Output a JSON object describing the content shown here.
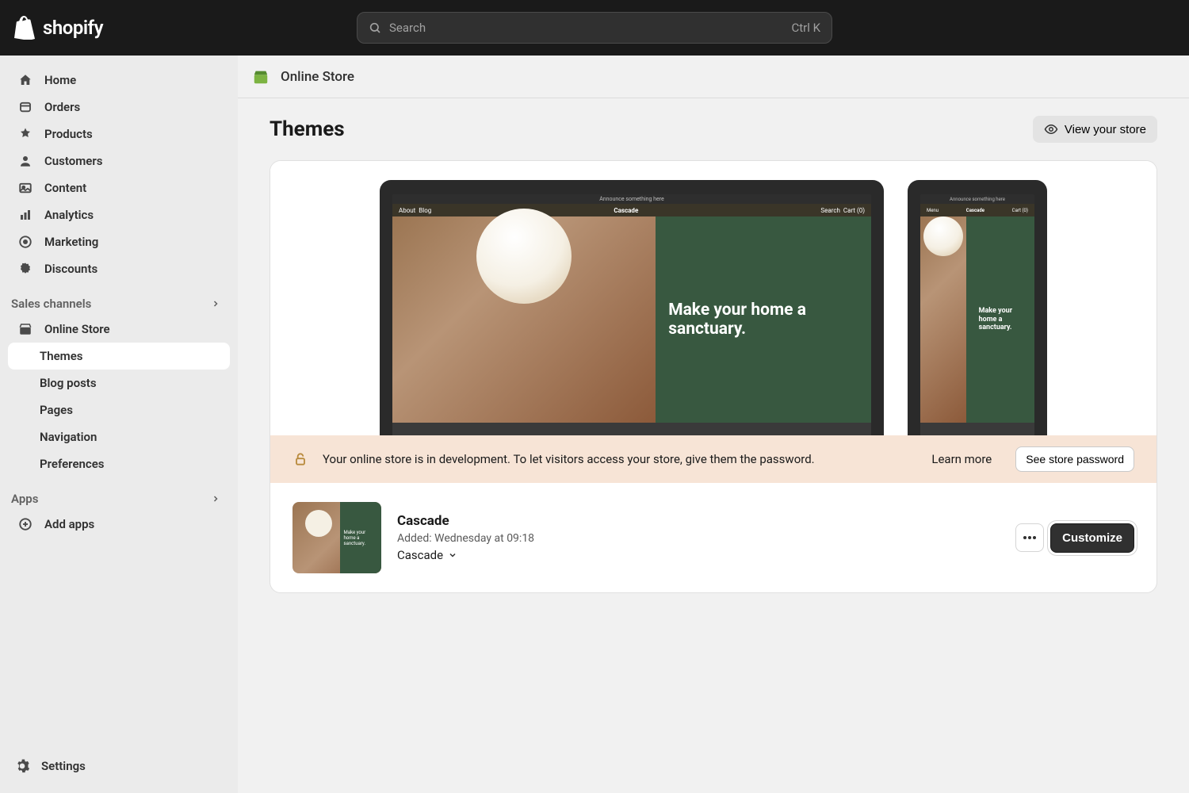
{
  "brand": "shopify",
  "search": {
    "placeholder": "Search",
    "shortcut": "Ctrl K"
  },
  "sidebar": {
    "nav": {
      "home": "Home",
      "orders": "Orders",
      "products": "Products",
      "customers": "Customers",
      "content": "Content",
      "analytics": "Analytics",
      "marketing": "Marketing",
      "discounts": "Discounts"
    },
    "sales_head": "Sales channels",
    "online_store": "Online Store",
    "os_sub": {
      "themes": "Themes",
      "blog": "Blog posts",
      "pages": "Pages",
      "navigation": "Navigation",
      "preferences": "Preferences"
    },
    "apps_head": "Apps",
    "add_apps": "Add apps",
    "settings": "Settings"
  },
  "breadcrumb": "Online Store",
  "page_title": "Themes",
  "view_store_btn": "View your store",
  "preview": {
    "announce": "Announce something here",
    "brand": "Cascade",
    "nav_left": "About  Blog",
    "nav_menu": "Menu",
    "nav_right": "Search  Cart (0)",
    "nav_right_m": "Cart (0)",
    "hero": "Make your home a sanctuary."
  },
  "banner": {
    "message": "Your online store is in development. To let visitors access your store, give them the password.",
    "learn_more": "Learn more",
    "see_password": "See store password"
  },
  "theme": {
    "name": "Cascade",
    "added": "Added: Wednesday at 09:18",
    "picker": "Cascade",
    "customize": "Customize"
  }
}
